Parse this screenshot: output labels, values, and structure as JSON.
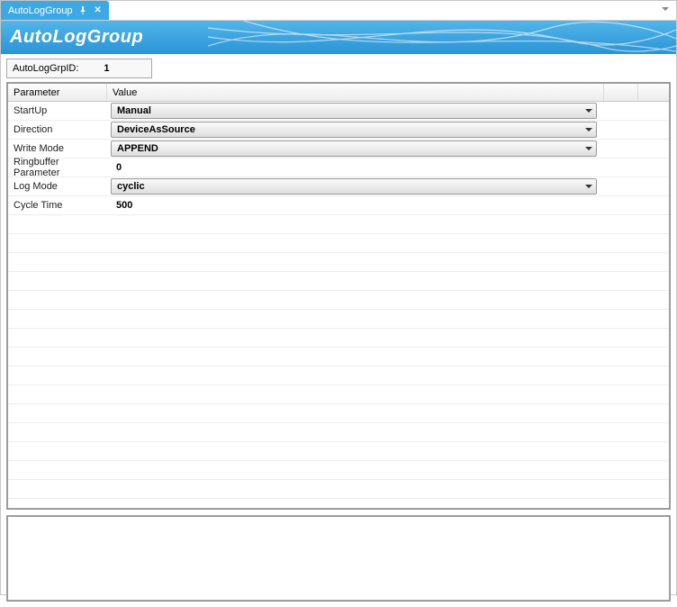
{
  "tab": {
    "label": "AutoLogGroup"
  },
  "header": {
    "title": "AutoLogGroup"
  },
  "idRow": {
    "label": "AutoLogGrpID:",
    "value": "1"
  },
  "grid": {
    "headers": {
      "param": "Parameter",
      "value": "Value"
    },
    "rows": [
      {
        "param": "StartUp",
        "type": "dropdown",
        "value": "Manual"
      },
      {
        "param": "Direction",
        "type": "dropdown",
        "value": "DeviceAsSource"
      },
      {
        "param": "Write Mode",
        "type": "dropdown",
        "value": "APPEND"
      },
      {
        "param": "Ringbuffer Parameter",
        "type": "text",
        "value": "0"
      },
      {
        "param": "Log Mode",
        "type": "dropdown",
        "value": "cyclic"
      },
      {
        "param": "Cycle Time",
        "type": "text",
        "value": "500"
      }
    ]
  }
}
